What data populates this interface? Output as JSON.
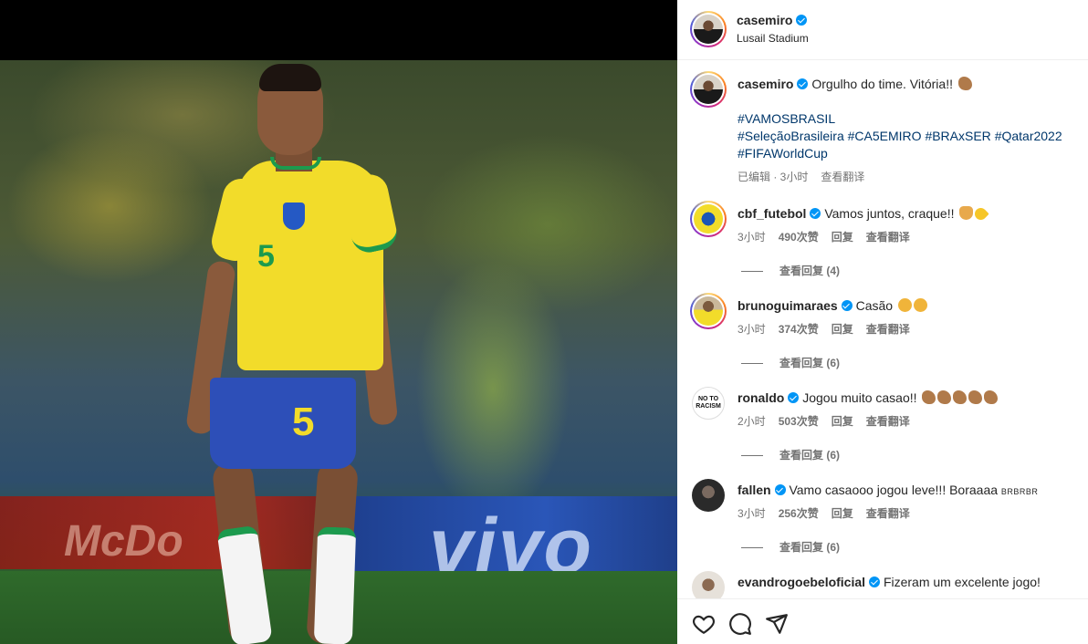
{
  "post": {
    "author": "casemiro",
    "location": "Lusail Stadium",
    "caption_user": "casemiro",
    "caption_text": "Orgulho do time. Vitória!!",
    "hashtags_line1": "#VAMOSBRASIL",
    "hashtags_line2": [
      "#SeleçãoBrasileira",
      "#CA5EMIRO",
      "#BRAxSER",
      "#Qatar2022"
    ],
    "hashtags_line3": "#FIFAWorldCup",
    "edited_label": "已编辑 · 3小时",
    "translate_label": "查看翻译"
  },
  "photo": {
    "jersey_number": "5",
    "billboard_text": "vivo",
    "billboard_left": "McDo"
  },
  "comments": [
    {
      "user": "cbf_futebol",
      "text": "Vamos juntos, craque!!",
      "emojis": [
        "pray",
        "yellow-heart"
      ],
      "time": "3小时",
      "likes": "490次赞",
      "reply": "回复",
      "translate": "查看翻译",
      "view_replies": "查看回复 (4)"
    },
    {
      "user": "brunoguimaraes",
      "text": "Casão",
      "emojis": [
        "clap",
        "clap"
      ],
      "time": "3小时",
      "likes": "374次赞",
      "reply": "回复",
      "translate": "查看翻译",
      "view_replies": "查看回复 (6)"
    },
    {
      "user": "ronaldo",
      "text": "Jogou muito casao!!",
      "emojis": [
        "arm",
        "arm",
        "arm",
        "arm",
        "arm"
      ],
      "time": "2小时",
      "likes": "503次赞",
      "reply": "回复",
      "translate": "查看翻译",
      "view_replies": "查看回复 (6)",
      "avatar_text": "NO TO RACISM"
    },
    {
      "user": "fallen",
      "text": "Vamo casaooo jogou leve!!! Boraaaa",
      "suffix": "BRBRBR",
      "time": "3小时",
      "likes": "256次赞",
      "reply": "回复",
      "translate": "查看翻译",
      "view_replies": "查看回复 (6)"
    },
    {
      "user": "evandrogoebeloficial",
      "text": "Fizeram um excelente jogo!",
      "time": "",
      "likes": "",
      "reply": "",
      "translate": "",
      "view_replies": ""
    }
  ],
  "actions": {
    "like_icon": "heart-icon",
    "comment_icon": "comment-icon",
    "share_icon": "share-icon"
  },
  "colors": {
    "verified": "#0095f6",
    "hashtag": "#00376b",
    "meta": "#737373"
  }
}
